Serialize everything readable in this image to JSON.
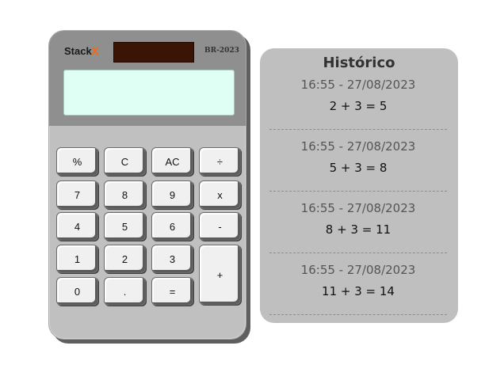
{
  "calculator": {
    "brand_main": "Stack",
    "brand_accent": "X",
    "model": "BR-2023",
    "display_value": "",
    "keys": {
      "percent": "%",
      "clear": "C",
      "all_clear": "AC",
      "divide": "÷",
      "seven": "7",
      "eight": "8",
      "nine": "9",
      "multiply": "x",
      "four": "4",
      "five": "5",
      "six": "6",
      "minus": "-",
      "one": "1",
      "two": "2",
      "three": "3",
      "plus": "+",
      "zero": "0",
      "decimal": ".",
      "equals": "="
    },
    "colors": {
      "body": "#c0c0c0",
      "top_panel": "#8f8f8f",
      "display": "#dffff4",
      "solar_panel": "#3a1405",
      "brand_accent": "#ff6600",
      "key_face": "#f0f0f0"
    }
  },
  "history": {
    "title": "Histórico",
    "entries": [
      {
        "time": "16:55 - 27/08/2023",
        "expression": "2 + 3 = 5"
      },
      {
        "time": "16:55 - 27/08/2023",
        "expression": "5 + 3 = 8"
      },
      {
        "time": "16:55 - 27/08/2023",
        "expression": "8 + 3 = 11"
      },
      {
        "time": "16:55 - 27/08/2023",
        "expression": "11 + 3 = 14"
      }
    ],
    "colors": {
      "panel": "#bfbfbf"
    }
  }
}
